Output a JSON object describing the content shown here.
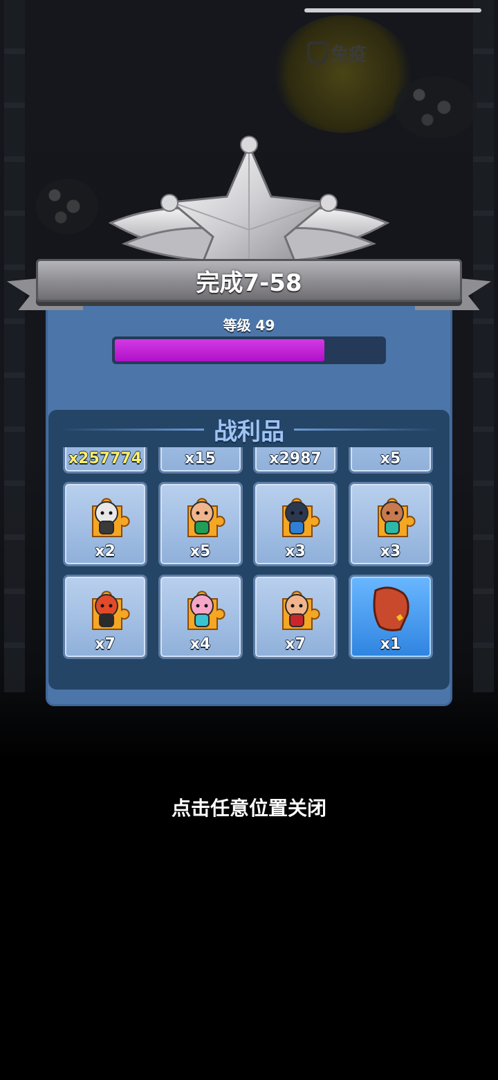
{
  "background": {
    "immune_label": "免疫"
  },
  "result": {
    "title": "完成7-58",
    "level_label": "等级 49",
    "xp_progress": 0.78
  },
  "loot": {
    "title": "战利品",
    "items": [
      {
        "icon": "gold-gem-icon",
        "qty": "x257774",
        "highlight": true
      },
      {
        "icon": "green-gem-icon",
        "qty": "x15"
      },
      {
        "icon": "blue-gem-icon",
        "qty": "x2987"
      },
      {
        "icon": "hero-puzzle-red-girl-icon",
        "qty": "x5"
      },
      {
        "icon": "hero-puzzle-skull-icon",
        "qty": "x2"
      },
      {
        "icon": "hero-puzzle-green-hair-icon",
        "qty": "x5"
      },
      {
        "icon": "hero-puzzle-panther-icon",
        "qty": "x3"
      },
      {
        "icon": "hero-puzzle-warrior-girl-icon",
        "qty": "x3"
      },
      {
        "icon": "hero-puzzle-robot-icon",
        "qty": "x7"
      },
      {
        "icon": "hero-puzzle-pink-hair-icon",
        "qty": "x4"
      },
      {
        "icon": "hero-puzzle-red-hat-icon",
        "qty": "x7"
      },
      {
        "icon": "boxing-glove-icon",
        "qty": "x1",
        "rare": true
      }
    ]
  },
  "close_hint": "点击任意位置关闭",
  "colors": {
    "panel": "#4c76a9",
    "xp_fill": "#c224d8",
    "loot_title": "#9ec4f6",
    "gold_text": "#fbf06b"
  }
}
